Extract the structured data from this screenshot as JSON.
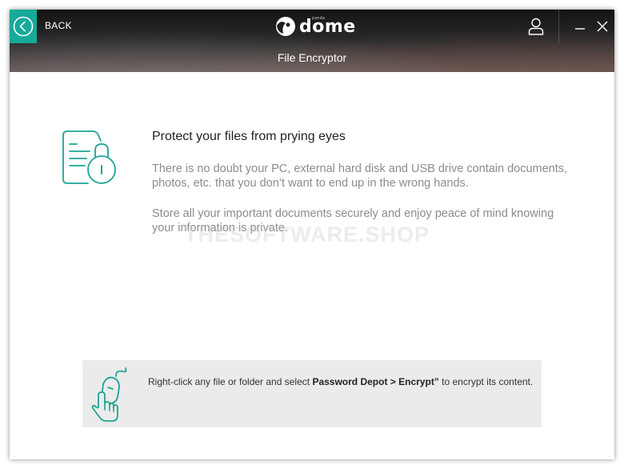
{
  "header": {
    "back_label": "BACK",
    "logo_text": "dome",
    "logo_small": "panda",
    "page_title": "File Encryptor"
  },
  "content": {
    "heading": "Protect your files from prying eyes",
    "paragraph_1": "There is no doubt your PC, external hard disk and USB drive contain documents, photos, etc. that you don’t want to end up in the wrong hands.",
    "paragraph_2": "Store all your important documents securely and enjoy peace of mind knowing your information is private."
  },
  "watermark": "THESOFTWARE.SHOP",
  "tip": {
    "text_before": "Right-click any file or folder and select ",
    "text_bold": "Password Depot > Encrypt”",
    "text_after": " to encrypt its content."
  },
  "colors": {
    "accent": "#17a99a",
    "icon_teal": "#1aa596",
    "tip_background": "#ebebeb"
  },
  "icons": {
    "back": "chevron-left-circle-icon",
    "user": "user-icon",
    "minimize": "minimize-icon",
    "close": "close-icon",
    "document_lock": "document-lock-icon",
    "mouse_hand": "mouse-hand-icon"
  }
}
